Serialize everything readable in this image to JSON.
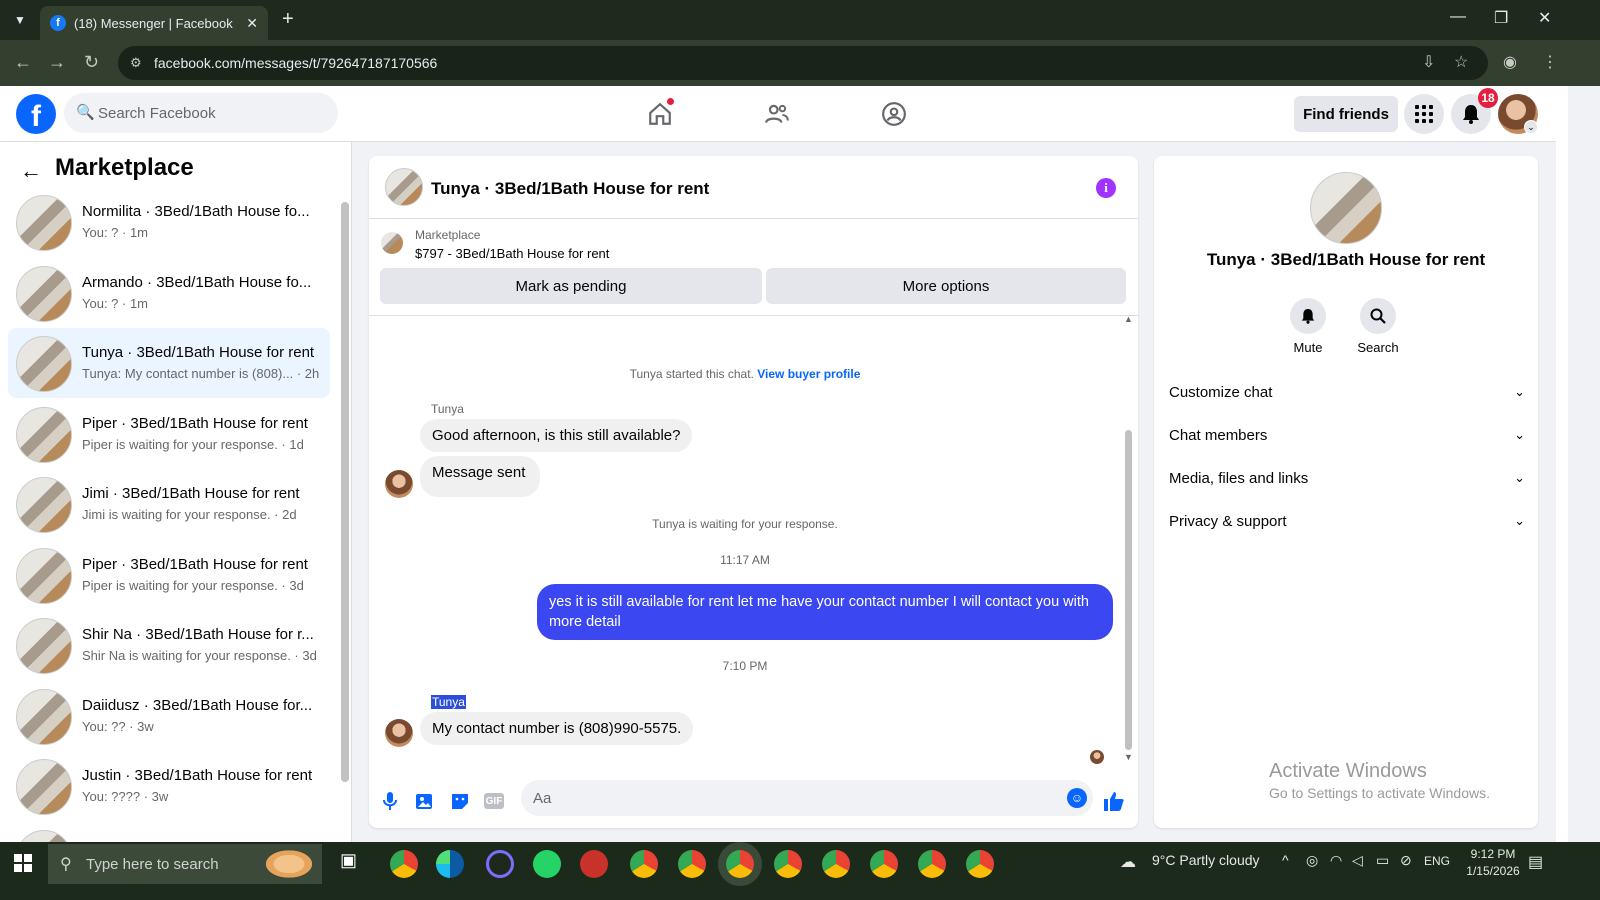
{
  "browser": {
    "tab_title": "(18) Messenger | Facebook",
    "url": "facebook.com/messages/t/792647187170566"
  },
  "fb": {
    "search_placeholder": "Search Facebook",
    "find_friends": "Find friends",
    "notif_count": "18",
    "brand_color": "#0866ff"
  },
  "left": {
    "title": "Marketplace",
    "conversations": [
      {
        "name": "Normilita · 3Bed/1Bath House fo...",
        "sub": "You: ? · 1m"
      },
      {
        "name": "Armando · 3Bed/1Bath House fo...",
        "sub": "You: ? · 1m"
      },
      {
        "name": "Tunya · 3Bed/1Bath House for rent",
        "sub": "Tunya: My contact number is (808)... · 2h"
      },
      {
        "name": "Piper · 3Bed/1Bath House for rent",
        "sub": "Piper is waiting for your response. · 1d"
      },
      {
        "name": "Jimi · 3Bed/1Bath House for rent",
        "sub": "Jimi is waiting for your response. · 2d"
      },
      {
        "name": "Piper · 3Bed/1Bath House for rent",
        "sub": "Piper is waiting for your response. · 3d"
      },
      {
        "name": "Shir Na · 3Bed/1Bath House for r...",
        "sub": "Shir Na is waiting for your response. · 3d"
      },
      {
        "name": "Daiidusz · 3Bed/1Bath House for...",
        "sub": "You: ?? · 3w"
      },
      {
        "name": "Justin · 3Bed/1Bath House for rent",
        "sub": "You: ???? · 3w"
      }
    ]
  },
  "chat": {
    "title": "Tunya · 3Bed/1Bath House for rent",
    "marketplace_label": "Marketplace",
    "listing": "$797 - 3Bed/1Bath House for rent",
    "mark_pending": "Mark as pending",
    "more_options": "More options",
    "started": "Tunya started this chat.",
    "view_profile": "View buyer profile",
    "sender": "Tunya",
    "msg1": "Good afternoon, is this still available?",
    "msg2": "Message sent",
    "waiting": "Tunya is waiting for your response.",
    "time1": "11:17 AM",
    "out_msg": "yes it is still available for rent let me have your contact number I will contact you with more detail",
    "time2": "7:10 PM",
    "sender2": "Tunya",
    "msg3": "My contact number is (808)990-5575.",
    "composer_placeholder": "Aa",
    "outgoing_color": "#3b47f0"
  },
  "right": {
    "name": "Tunya · 3Bed/1Bath House for rent",
    "mute": "Mute",
    "search": "Search",
    "sections": [
      "Customize chat",
      "Chat members",
      "Media, files and links",
      "Privacy & support"
    ]
  },
  "watermark": {
    "line1": "Activate Windows",
    "line2": "Go to Settings to activate Windows."
  },
  "taskbar": {
    "search_placeholder": "Type here to search",
    "weather": "9°C  Partly cloudy",
    "lang": "ENG",
    "time": "9:12 PM",
    "date": "1/15/2026"
  }
}
